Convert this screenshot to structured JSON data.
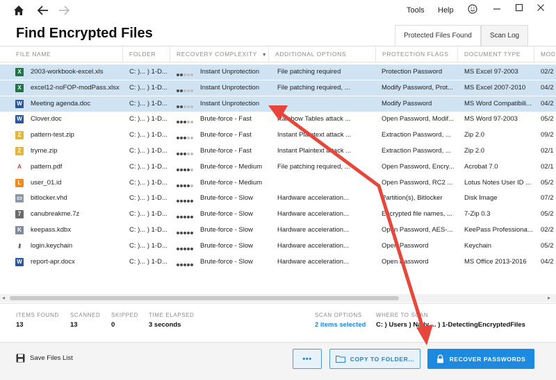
{
  "window": {
    "menu": [
      "Tools",
      "Help"
    ],
    "nav_icons": [
      "home-icon",
      "back-arrow-icon",
      "forward-arrow-icon"
    ],
    "window_controls": [
      "minimize-icon",
      "maximize-icon",
      "close-icon"
    ]
  },
  "page": {
    "title": "Find Encrypted Files",
    "tabs": [
      {
        "label": "Protected Files Found",
        "active": true
      },
      {
        "label": "Scan Log",
        "active": false
      }
    ]
  },
  "table": {
    "columns": [
      "FILE NAME",
      "FOLDER",
      "RECOVERY COMPLEXITY",
      "ADDITIONAL OPTIONS",
      "PROTECTION FLAGS",
      "DOCUMENT TYPE",
      "MOD"
    ],
    "sorted_column_icon": "sort-down-icon",
    "rows": [
      {
        "icon": "excel-icon",
        "name": "2003-workbook-excel.xls",
        "folder": "C: )... ) 1-D...",
        "level": 1,
        "complexity": "Instant Unprotection",
        "options": "File patching required",
        "flags": "Protection Password",
        "type": "MS Excel 97-2003",
        "mod": "02/2",
        "selected": true
      },
      {
        "icon": "excel-icon",
        "name": "excel12-noFOP-modPass.xlsx",
        "folder": "C: )... ) 1-D...",
        "level": 1,
        "complexity": "Instant Unprotection",
        "options": "File patching required, ...",
        "flags": "Modify Password, Prot...",
        "type": "MS Excel 2007-2010",
        "mod": "04/2",
        "selected": true
      },
      {
        "icon": "word-icon",
        "name": "Meeting agenda.doc",
        "folder": "C: )... ) 1-D...",
        "level": 1,
        "complexity": "Instant Unprotection",
        "options": "",
        "flags": "Modify Password",
        "type": "MS Word Compatibili...",
        "mod": "04/2",
        "selected": true
      },
      {
        "icon": "word-icon",
        "name": "Clover.doc",
        "folder": "C: )... ) 1-D...",
        "level": 2,
        "complexity": "Brute-force - Fast",
        "options": "Rainbow Tables attack ...",
        "flags": "Open Password, Modif...",
        "type": "MS Word 97-2003",
        "mod": "05/2",
        "selected": false
      },
      {
        "icon": "zip-icon",
        "name": "pattern-test.zip",
        "folder": "C: )... ) 1-D...",
        "level": 2,
        "complexity": "Brute-force - Fast",
        "options": "Instant Plaintext attack ...",
        "flags": "Extraction Password, ...",
        "type": "Zip 2.0",
        "mod": "09/2",
        "selected": false
      },
      {
        "icon": "zip-icon",
        "name": "tryme.zip",
        "folder": "C: )... ) 1-D...",
        "level": 2,
        "complexity": "Brute-force - Fast",
        "options": "Instant Plaintext attack ...",
        "flags": "Extraction Password, ...",
        "type": "Zip 2.0",
        "mod": "02/1",
        "selected": false
      },
      {
        "icon": "pdf-icon",
        "name": "pattern.pdf",
        "folder": "C: )... ) 1-D...",
        "level": 3,
        "complexity": "Brute-force - Medium",
        "options": "File patching required, ...",
        "flags": "Open Password, Encry...",
        "type": "Acrobat 7.0",
        "mod": "02/1",
        "selected": false
      },
      {
        "icon": "lotus-icon",
        "name": "user_01.id",
        "folder": "C: )... ) 1-D...",
        "level": 3,
        "complexity": "Brute-force - Medium",
        "options": "",
        "flags": "Open Password, RC2 ...",
        "type": "Lotus Notes User ID ...",
        "mod": "05/2",
        "selected": false
      },
      {
        "icon": "disk-icon",
        "name": "bitlocker.vhd",
        "folder": "C: )... ) 1-D...",
        "level": 4,
        "complexity": "Brute-force - Slow",
        "options": "Hardware acceleration...",
        "flags": "Partition(s), Bitlocker",
        "type": "Disk Image",
        "mod": "07/2",
        "selected": false
      },
      {
        "icon": "archive-icon",
        "name": "canubreakme.7z",
        "folder": "C: )... ) 1-D...",
        "level": 4,
        "complexity": "Brute-force - Slow",
        "options": "Hardware acceleration...",
        "flags": "Encrypted file names, ...",
        "type": "7-Zip 0.3",
        "mod": "05/2",
        "selected": false
      },
      {
        "icon": "lock-file-icon",
        "name": "keepass.kdbx",
        "folder": "C: )... ) 1-D...",
        "level": 4,
        "complexity": "Brute-force - Slow",
        "options": "Hardware acceleration...",
        "flags": "Open Password, AES-...",
        "type": "KeePass Professiona...",
        "mod": "02/2",
        "selected": false
      },
      {
        "icon": "keychain-icon",
        "name": "login.keychain",
        "folder": "C: )... ) 1-D...",
        "level": 4,
        "complexity": "Brute-force - Slow",
        "options": "Hardware acceleration...",
        "flags": "Open Password",
        "type": "Keychain",
        "mod": "05/2",
        "selected": false
      },
      {
        "icon": "word-icon",
        "name": "report-apr.docx",
        "folder": "C: )... ) 1-D...",
        "level": 4,
        "complexity": "Brute-force - Slow",
        "options": "Hardware acceleration...",
        "flags": "Open Password",
        "type": "MS Office 2013-2016",
        "mod": "04/2",
        "selected": false
      }
    ]
  },
  "stats": {
    "items_found": {
      "label": "ITEMS FOUND",
      "value": "13"
    },
    "scanned": {
      "label": "SCANNED",
      "value": "13"
    },
    "skipped": {
      "label": "SKIPPED",
      "value": "0"
    },
    "time_elapsed": {
      "label": "TIME ELAPSED",
      "value": "3 seconds"
    },
    "scan_options": {
      "label": "SCAN OPTIONS",
      "value": "2 items selected"
    },
    "where_to_scan": {
      "label": "WHERE TO SCAN",
      "value": "C: ) Users ) Na.ly ... ) 1-DetectingEncryptedFiles"
    }
  },
  "footer": {
    "save_label": "Save Files List",
    "more_label": "•••",
    "copy_label": "COPY TO FOLDER...",
    "recover_label": "RECOVER PASSWORDS"
  },
  "colors": {
    "accent": "#1d8ae0",
    "selected_row": "#cfe3f3",
    "annotation_arrow": "#e8463a",
    "dot_filled": "#4a4a4a",
    "dot_empty": "#bdbdbd"
  }
}
